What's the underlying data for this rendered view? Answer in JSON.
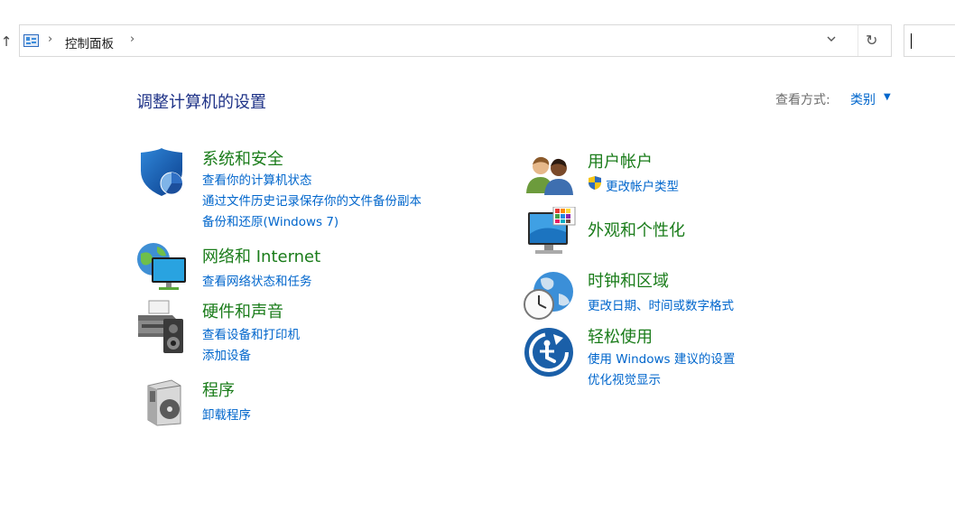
{
  "address_bar": {
    "breadcrumb": "控制面板",
    "refresh_glyph": "↻",
    "dropdown_glyph": "⌄"
  },
  "header": {
    "title": "调整计算机的设置",
    "view_by_label": "查看方式:",
    "view_by_value": "类别"
  },
  "categories_left": [
    {
      "title": "系统和安全",
      "icon": "shield-icon",
      "links": [
        "查看你的计算机状态",
        "通过文件历史记录保存你的文件备份副本",
        "备份和还原(Windows 7)"
      ]
    },
    {
      "title": "网络和 Internet",
      "icon": "network-globe-icon",
      "links": [
        "查看网络状态和任务"
      ]
    },
    {
      "title": "硬件和声音",
      "icon": "printer-speaker-icon",
      "links": [
        "查看设备和打印机",
        "添加设备"
      ]
    },
    {
      "title": "程序",
      "icon": "programs-disc-icon",
      "links": [
        "卸载程序"
      ]
    }
  ],
  "categories_right": [
    {
      "title": "用户帐户",
      "icon": "users-icon",
      "links": [
        "更改帐户类型"
      ],
      "link_icon": "uac-shield-icon"
    },
    {
      "title": "外观和个性化",
      "icon": "monitor-palette-icon",
      "links": []
    },
    {
      "title": "时钟和区域",
      "icon": "clock-globe-icon",
      "links": [
        "更改日期、时间或数字格式"
      ]
    },
    {
      "title": "轻松使用",
      "icon": "ease-of-access-icon",
      "links": [
        "使用 Windows 建议的设置",
        "优化视觉显示"
      ]
    }
  ],
  "colors": {
    "title_blue": "#1e3287",
    "category_green": "#1a7c1a",
    "link_blue": "#0066cc"
  }
}
